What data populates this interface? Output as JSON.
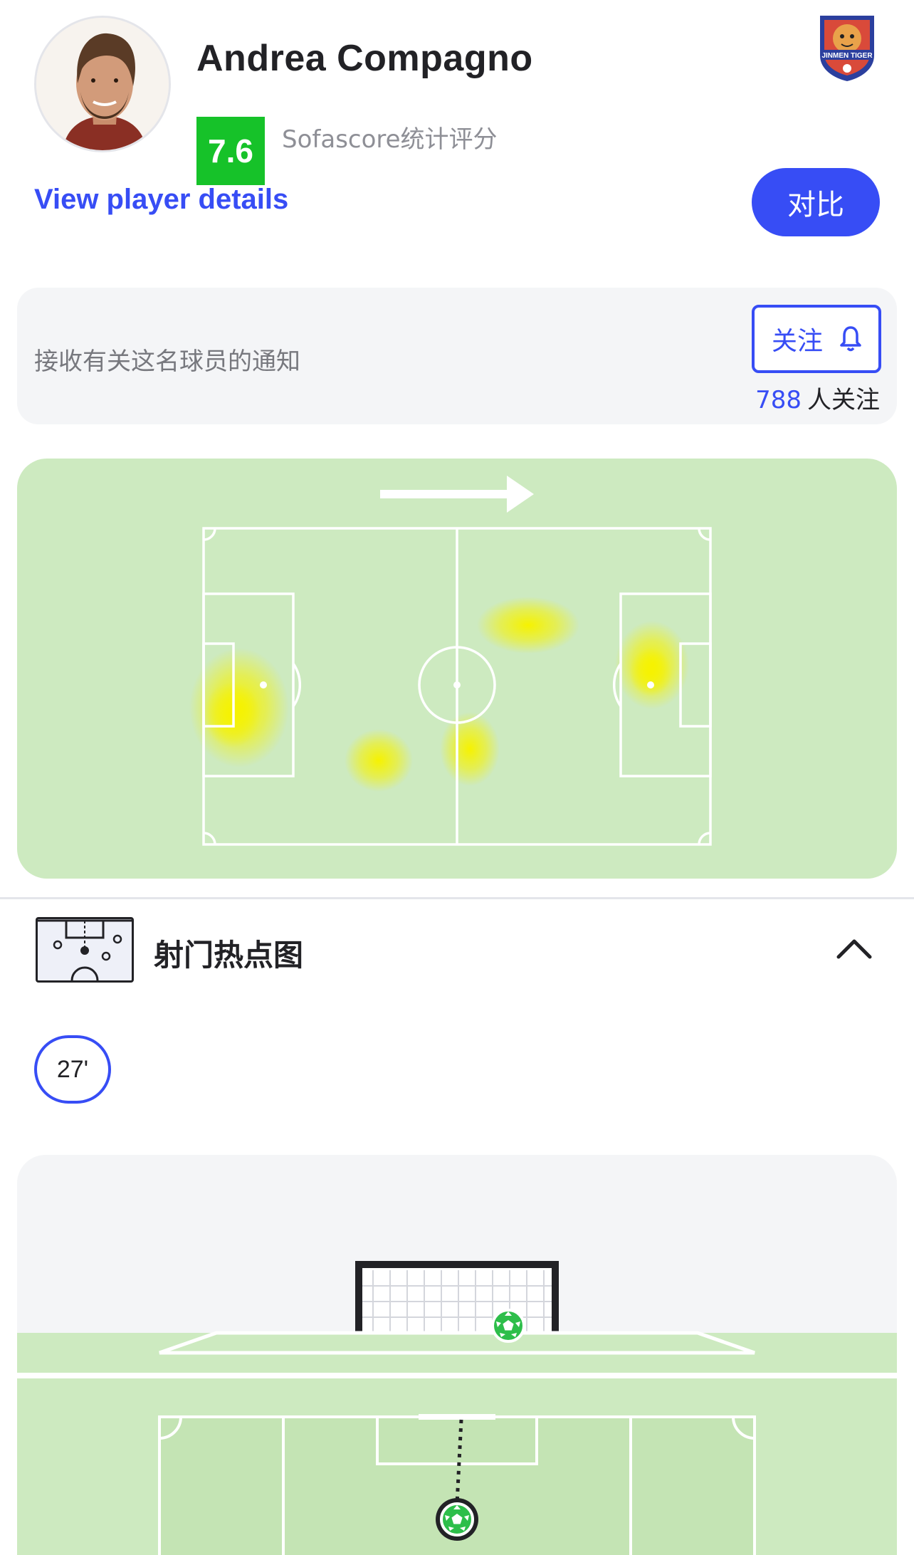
{
  "player": {
    "name": "Andrea Compagno",
    "rating": "7.6",
    "rating_label": "Sofascore统计评分",
    "details_link": "View player details",
    "compare_label": "对比",
    "team_logo_text": "JINMEN TIGER"
  },
  "notifications": {
    "text": "接收有关这名球员的通知",
    "follow_label": "关注",
    "followers_count": "788",
    "followers_suffix": "人关注"
  },
  "heatmap": {
    "attack_direction": "right",
    "hot_zones": [
      {
        "area": "left penalty area",
        "intensity": "high"
      },
      {
        "area": "right penalty area",
        "intensity": "high"
      },
      {
        "area": "right half, upper",
        "intensity": "medium"
      },
      {
        "area": "left half, lower",
        "intensity": "low"
      },
      {
        "area": "center, lower",
        "intensity": "low"
      }
    ]
  },
  "shotmap": {
    "title": "射门热点图",
    "selected_minute": "27'",
    "outcome": "goal"
  },
  "colors": {
    "accent": "#374df5",
    "rating_green": "#16c229",
    "pitch_green": "#cdeac0",
    "card_bg": "#f4f5f7",
    "heat_yellow": "#f6f200"
  }
}
